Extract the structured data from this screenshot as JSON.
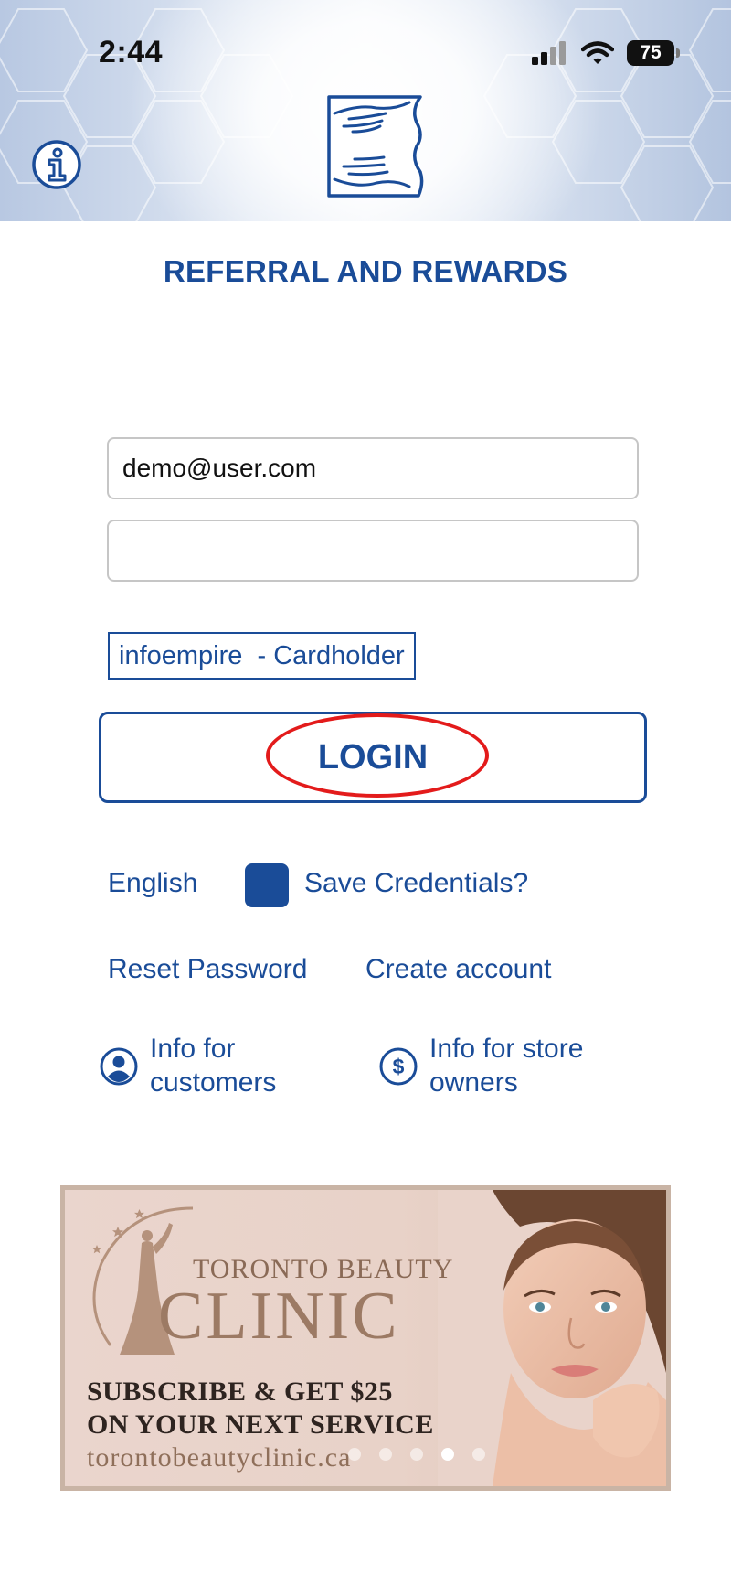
{
  "status_bar": {
    "time": "2:44",
    "battery": "75"
  },
  "icons": {
    "info": "info-circle-icon",
    "logo": "hands-logo-icon",
    "signal": "cellular-signal-icon",
    "wifi": "wifi-icon",
    "customer": "user-circle-icon",
    "store": "dollar-circle-icon"
  },
  "app": {
    "title": "REFERRAL AND REWARDS"
  },
  "login_form": {
    "email_value": "demo@user.com",
    "password_value": "",
    "account_type": "infoempire  - Cardholder",
    "login_label": "LOGIN"
  },
  "options": {
    "language": "English",
    "save_credentials_label": "Save Credentials?",
    "save_credentials_checked": true
  },
  "links": {
    "reset_password": "Reset Password",
    "create_account": "Create account",
    "info_customers_line1": "Info for",
    "info_customers_line2": "customers",
    "info_store_line1": "Info for store",
    "info_store_line2": "owners"
  },
  "banner": {
    "brand_line1": "TORONTO BEAUTY",
    "brand_line2": "CLINIC",
    "offer_line1": "SUBSCRIBE & GET $25",
    "offer_line2": "ON YOUR NEXT SERVICE",
    "url": "torontobeautyclinic.ca",
    "slides_total": 5,
    "active_slide": 4
  },
  "colors": {
    "brand_blue": "#1a4c98",
    "highlight_red": "#e31b1b",
    "banner_bg": "#ead5cd"
  }
}
